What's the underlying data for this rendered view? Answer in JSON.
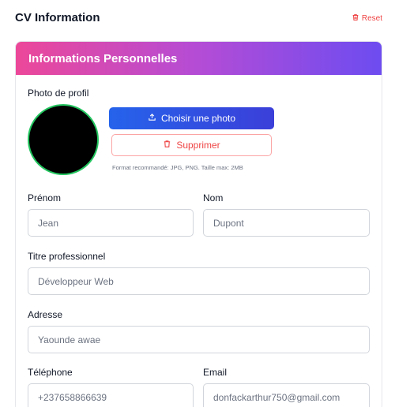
{
  "header": {
    "title": "CV Information",
    "reset_label": "Reset"
  },
  "section": {
    "title": "Informations Personnelles"
  },
  "photo": {
    "label": "Photo de profil",
    "choose_label": "Choisir une photo",
    "delete_label": "Supprimer",
    "hint": "Format recommandé: JPG, PNG. Taille max: 2MB"
  },
  "fields": {
    "first_name": {
      "label": "Prénom",
      "value": "Jean"
    },
    "last_name": {
      "label": "Nom",
      "value": "Dupont"
    },
    "job_title": {
      "label": "Titre professionnel",
      "value": "Développeur Web"
    },
    "address": {
      "label": "Adresse",
      "value": "Yaounde awae"
    },
    "phone": {
      "label": "Téléphone",
      "value": "+237658866639"
    },
    "email": {
      "label": "Email",
      "value": "donfackarthur750@gmail.com"
    }
  },
  "colors": {
    "accent": "#2563eb",
    "danger": "#ef4444",
    "gradient_start": "#ec4899",
    "gradient_end": "#6d4cf0",
    "avatar_border": "#22c55e"
  },
  "icons": [
    "trash-icon",
    "upload-icon"
  ]
}
